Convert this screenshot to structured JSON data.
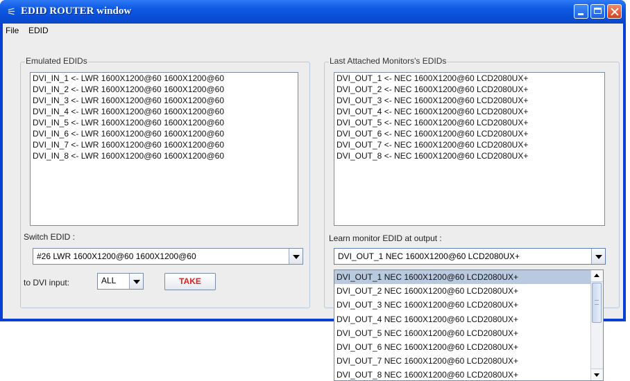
{
  "window": {
    "title": "EDID ROUTER window",
    "icon": "router-icon"
  },
  "menu": [
    "File",
    "EDID"
  ],
  "emulated": {
    "legend": "Emulated EDIDs",
    "items": [
      "DVI_IN_1 <-  LWR 1600X1200@60 1600X1200@60",
      "DVI_IN_2 <-  LWR 1600X1200@60 1600X1200@60",
      "DVI_IN_3 <-  LWR 1600X1200@60 1600X1200@60",
      "DVI_IN_4 <-  LWR 1600X1200@60 1600X1200@60",
      "DVI_IN_5 <-  LWR 1600X1200@60 1600X1200@60",
      "DVI_IN_6 <-  LWR 1600X1200@60 1600X1200@60",
      "DVI_IN_7 <-  LWR 1600X1200@60 1600X1200@60",
      "DVI_IN_8 <-  LWR 1600X1200@60 1600X1200@60"
    ],
    "switch_label": "Switch EDID :",
    "switch_value": "#26 LWR 1600X1200@60 1600X1200@60",
    "to_input_label": "to DVI input:",
    "to_input_value": "ALL",
    "take_label": "TAKE",
    "take_color": "#e02020"
  },
  "monitors": {
    "legend": "Last Attached Monitors's EDIDs",
    "items": [
      "DVI_OUT_1 <-  NEC 1600X1200@60 LCD2080UX+",
      "DVI_OUT_2 <-  NEC 1600X1200@60 LCD2080UX+",
      "DVI_OUT_3 <-  NEC 1600X1200@60 LCD2080UX+",
      "DVI_OUT_4 <-  NEC 1600X1200@60 LCD2080UX+",
      "DVI_OUT_5 <-  NEC 1600X1200@60 LCD2080UX+",
      "DVI_OUT_6 <-  NEC 1600X1200@60 LCD2080UX+",
      "DVI_OUT_7 <-  NEC 1600X1200@60 LCD2080UX+",
      "DVI_OUT_8 <-  NEC 1600X1200@60 LCD2080UX+"
    ],
    "learn_label": "Learn monitor EDID at output :",
    "learn_value": "DVI_OUT_1  NEC 1600X1200@60 LCD2080UX+",
    "dropdown_options": [
      "DVI_OUT_1  NEC 1600X1200@60 LCD2080UX+",
      "DVI_OUT_2  NEC 1600X1200@60 LCD2080UX+",
      "DVI_OUT_3  NEC 1600X1200@60 LCD2080UX+",
      "DVI_OUT_4  NEC 1600X1200@60 LCD2080UX+",
      "DVI_OUT_5  NEC 1600X1200@60 LCD2080UX+",
      "DVI_OUT_6  NEC 1600X1200@60 LCD2080UX+",
      "DVI_OUT_7  NEC 1600X1200@60 LCD2080UX+",
      "DVI_OUT_8  NEC 1600X1200@60 LCD2080UX+"
    ],
    "selected_index": 0
  }
}
